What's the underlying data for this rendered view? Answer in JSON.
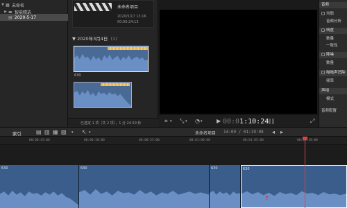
{
  "library": {
    "items": [
      {
        "label": "未命名",
        "glyph": "▦",
        "expanded": true,
        "selected": false,
        "indent": 0
      },
      {
        "label": "智能精选",
        "glyph": "▬",
        "expanded": false,
        "selected": false,
        "indent": 1
      },
      {
        "label": "2020-5-17",
        "glyph": "▤",
        "expanded": false,
        "selected": true,
        "indent": 1
      }
    ]
  },
  "browser": {
    "project": {
      "name": "未命名项目",
      "date": "2020/5/17 13:16",
      "duration": "00:00:24:13"
    },
    "group": {
      "title": "2020年3月4日",
      "count": "(1)"
    },
    "clips": [
      {
        "label": "630"
      }
    ],
    "status": "已选定 1 项（共 2 项），1 分 24.59 秒"
  },
  "viewer": {
    "timecode": "1:10:24",
    "timecode_prefix": "00:0"
  },
  "inspector": {
    "rows": [
      {
        "label": "音频",
        "band": true
      },
      {
        "label": "均衡",
        "band": false,
        "check": true
      },
      {
        "label": "音频分析",
        "band": false
      },
      {
        "label": "response",
        "band": true,
        "check": true,
        "display": "响度"
      },
      {
        "label": "数量",
        "band": false
      },
      {
        "label": "一致性",
        "band": false
      },
      {
        "label": "降噪",
        "band": true,
        "check": true
      },
      {
        "label": "数量",
        "band": false
      },
      {
        "label": "嗡嗡声消除",
        "band": true,
        "check": true
      },
      {
        "label": "频率",
        "band": false
      },
      {
        "label": "声相",
        "band": true
      },
      {
        "label": "模式",
        "band": false
      },
      {
        "label": "音频配置",
        "band": false
      }
    ]
  },
  "timeline": {
    "index_label": "索引",
    "project_title": "未命名项目",
    "position": "14:09 / 01:19:08",
    "ruler": [
      "00:00:45:00",
      "00:00:50:00",
      "00:00:55:00",
      "00:01:00:00",
      "00:01:05:00",
      "00:01:10:00"
    ],
    "clips": [
      {
        "name": "630"
      },
      {
        "name": "630"
      },
      {
        "name": "630"
      },
      {
        "name": "630"
      }
    ]
  },
  "colors": {
    "accent": "#f0b04a",
    "playhead": "#d24545",
    "clip": "#3a5d8c"
  }
}
